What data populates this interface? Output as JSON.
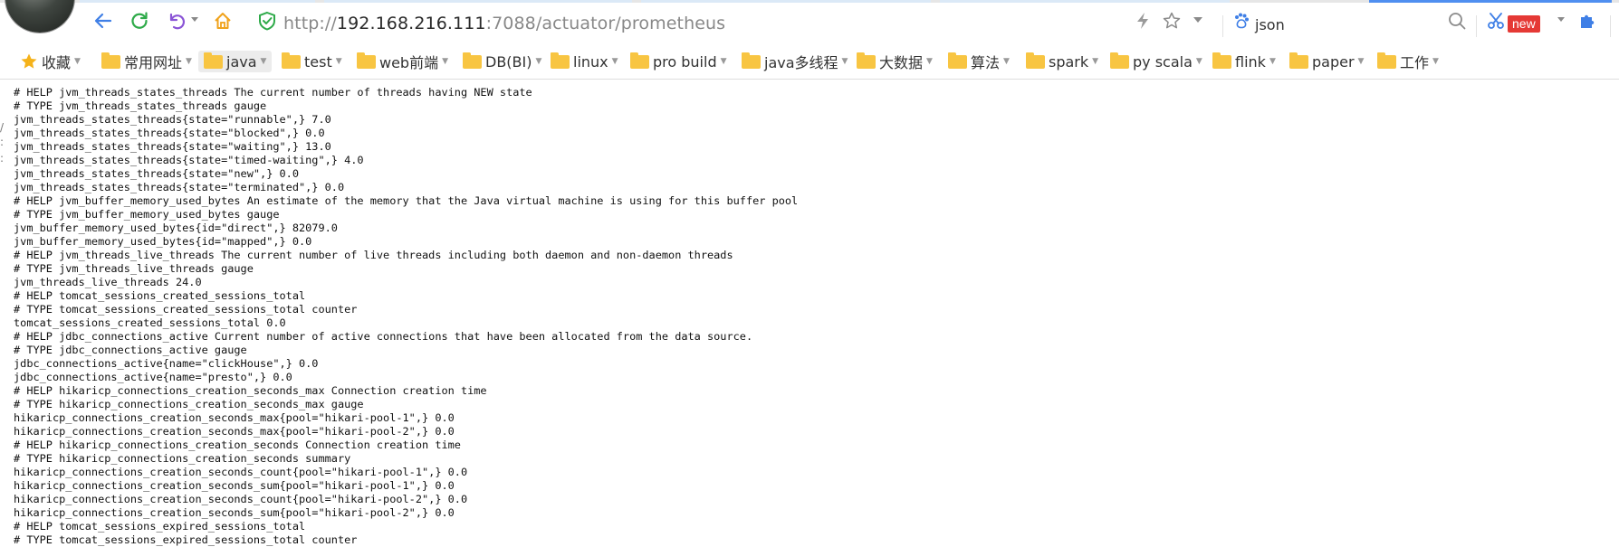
{
  "browser": {
    "url_prefix": "http://",
    "url_host": "192.168.216.111",
    "url_path": ":7088/actuator/prometheus",
    "search_text": "json",
    "new_badge": "new"
  },
  "bookmarks": [
    {
      "label": "收藏",
      "icon": "star-icon"
    },
    {
      "label": "常用网址",
      "icon": "folder-icon"
    },
    {
      "label": "java",
      "icon": "folder-icon",
      "active": true
    },
    {
      "label": "test",
      "icon": "folder-icon"
    },
    {
      "label": "web前端",
      "icon": "folder-icon"
    },
    {
      "label": "DB(BI)",
      "icon": "folder-icon"
    },
    {
      "label": "linux",
      "icon": "folder-icon"
    },
    {
      "label": "pro build",
      "icon": "folder-icon"
    },
    {
      "label": "java多线程",
      "icon": "folder-icon"
    },
    {
      "label": "大数据",
      "icon": "folder-icon"
    },
    {
      "label": "算法",
      "icon": "folder-icon"
    },
    {
      "label": "spark",
      "icon": "folder-icon"
    },
    {
      "label": "py scala",
      "icon": "folder-icon"
    },
    {
      "label": "flink",
      "icon": "folder-icon"
    },
    {
      "label": "paper",
      "icon": "folder-icon"
    },
    {
      "label": "工作",
      "icon": "folder-icon"
    }
  ],
  "content_lines": [
    "# HELP jvm_threads_states_threads The current number of threads having NEW state",
    "# TYPE jvm_threads_states_threads gauge",
    "jvm_threads_states_threads{state=\"runnable\",} 7.0",
    "jvm_threads_states_threads{state=\"blocked\",} 0.0",
    "jvm_threads_states_threads{state=\"waiting\",} 13.0",
    "jvm_threads_states_threads{state=\"timed-waiting\",} 4.0",
    "jvm_threads_states_threads{state=\"new\",} 0.0",
    "jvm_threads_states_threads{state=\"terminated\",} 0.0",
    "# HELP jvm_buffer_memory_used_bytes An estimate of the memory that the Java virtual machine is using for this buffer pool",
    "# TYPE jvm_buffer_memory_used_bytes gauge",
    "jvm_buffer_memory_used_bytes{id=\"direct\",} 82079.0",
    "jvm_buffer_memory_used_bytes{id=\"mapped\",} 0.0",
    "# HELP jvm_threads_live_threads The current number of live threads including both daemon and non-daemon threads",
    "# TYPE jvm_threads_live_threads gauge",
    "jvm_threads_live_threads 24.0",
    "# HELP tomcat_sessions_created_sessions_total",
    "# TYPE tomcat_sessions_created_sessions_total counter",
    "tomcat_sessions_created_sessions_total 0.0",
    "# HELP jdbc_connections_active Current number of active connections that have been allocated from the data source.",
    "# TYPE jdbc_connections_active gauge",
    "jdbc_connections_active{name=\"clickHouse\",} 0.0",
    "jdbc_connections_active{name=\"presto\",} 0.0",
    "# HELP hikaricp_connections_creation_seconds_max Connection creation time",
    "# TYPE hikaricp_connections_creation_seconds_max gauge",
    "hikaricp_connections_creation_seconds_max{pool=\"hikari-pool-1\",} 0.0",
    "hikaricp_connections_creation_seconds_max{pool=\"hikari-pool-2\",} 0.0",
    "# HELP hikaricp_connections_creation_seconds Connection creation time",
    "# TYPE hikaricp_connections_creation_seconds summary",
    "hikaricp_connections_creation_seconds_count{pool=\"hikari-pool-1\",} 0.0",
    "hikaricp_connections_creation_seconds_sum{pool=\"hikari-pool-1\",} 0.0",
    "hikaricp_connections_creation_seconds_count{pool=\"hikari-pool-2\",} 0.0",
    "hikaricp_connections_creation_seconds_sum{pool=\"hikari-pool-2\",} 0.0",
    "# HELP tomcat_sessions_expired_sessions_total",
    "# TYPE tomcat_sessions_expired_sessions_total counter"
  ]
}
